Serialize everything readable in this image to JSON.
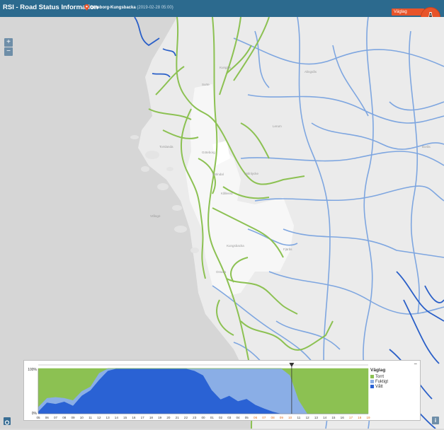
{
  "header": {
    "title": "RSI - Road Status Information",
    "location": "Göteborg-Kungsbacka",
    "datetime": "(2019-02-28 05:00)",
    "layer_label": "Väglag",
    "bg_color": "#2c6a8e",
    "accent_color": "#e8542a"
  },
  "map": {
    "zoom_in_label": "+",
    "zoom_out_label": "−",
    "colors": {
      "water": "#d6d6d6",
      "land": "#ebebeb",
      "urban": "#ffffff",
      "road_dry": "#8cc152",
      "road_moist": "#7ea6e0",
      "road_wet": "#2a5fc8"
    }
  },
  "chart_data": {
    "type": "area",
    "title": "",
    "ylabel": "",
    "yticks": [
      "100%",
      "0%"
    ],
    "ylim": [
      0,
      100
    ],
    "x": [
      "05",
      "06",
      "07",
      "08",
      "09",
      "10",
      "11",
      "12",
      "13",
      "14",
      "15",
      "16",
      "17",
      "18",
      "19",
      "20",
      "21",
      "22",
      "23",
      "00",
      "01",
      "02",
      "03",
      "04",
      "05",
      "06",
      "07",
      "08",
      "09",
      "10",
      "11",
      "12",
      "13",
      "14",
      "15",
      "16",
      "17",
      "18",
      "19"
    ],
    "highlight_ticks": [
      "06",
      "07",
      "08",
      "09",
      "10",
      "17",
      "18",
      "19"
    ],
    "highlight_color": "#e07020",
    "current_index": 30,
    "legend_title": "Väglag",
    "series": [
      {
        "name": "Vått",
        "color": "#2a62d4",
        "values": [
          5,
          25,
          22,
          27,
          18,
          40,
          52,
          75,
          95,
          100,
          100,
          100,
          100,
          100,
          100,
          100,
          100,
          100,
          95,
          85,
          52,
          32,
          40,
          28,
          33,
          20,
          12,
          5,
          0,
          0,
          0,
          0,
          0,
          0,
          0,
          0,
          0,
          0,
          0
        ]
      },
      {
        "name": "Fuktigt",
        "color": "#8aaee6",
        "values": [
          10,
          10,
          15,
          8,
          12,
          10,
          8,
          15,
          5,
          0,
          0,
          0,
          0,
          0,
          0,
          0,
          0,
          0,
          5,
          15,
          48,
          68,
          60,
          72,
          67,
          80,
          88,
          95,
          100,
          85,
          30,
          0,
          0,
          0,
          0,
          0,
          0,
          0,
          0
        ]
      },
      {
        "name": "Torrt",
        "color": "#8cc152",
        "values": [
          85,
          65,
          63,
          65,
          70,
          50,
          40,
          10,
          0,
          0,
          0,
          0,
          0,
          0,
          0,
          0,
          0,
          0,
          0,
          0,
          0,
          0,
          0,
          0,
          0,
          0,
          0,
          0,
          0,
          15,
          70,
          100,
          100,
          100,
          100,
          100,
          100,
          100,
          100
        ]
      }
    ]
  },
  "footer": {
    "info_label": "i"
  }
}
